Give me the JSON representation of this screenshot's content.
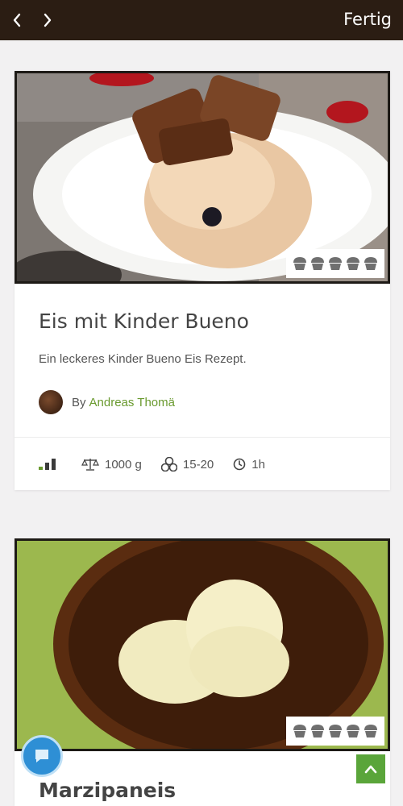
{
  "topbar": {
    "back_icon": "chevron-left-icon",
    "forward_icon": "chevron-right-icon",
    "done_label": "Fertig",
    "background": "#2b1d13"
  },
  "recipes": [
    {
      "title": "Eis mit Kinder Bueno",
      "description": "Ein leckeres Kinder Bueno Eis Rezept.",
      "by_label": "By",
      "author": "Andreas Thomä",
      "rating_icons": 5,
      "difficulty_level": "2 of 3",
      "weight": "1000 g",
      "servings": "15-20",
      "time": "1h"
    },
    {
      "title": "Marzipaneis",
      "rating_icons": 5
    }
  ],
  "colors": {
    "accent_green": "#6a9a2f",
    "chat_blue": "#2e8fd5",
    "scroll_top_green": "#5aa53a"
  }
}
